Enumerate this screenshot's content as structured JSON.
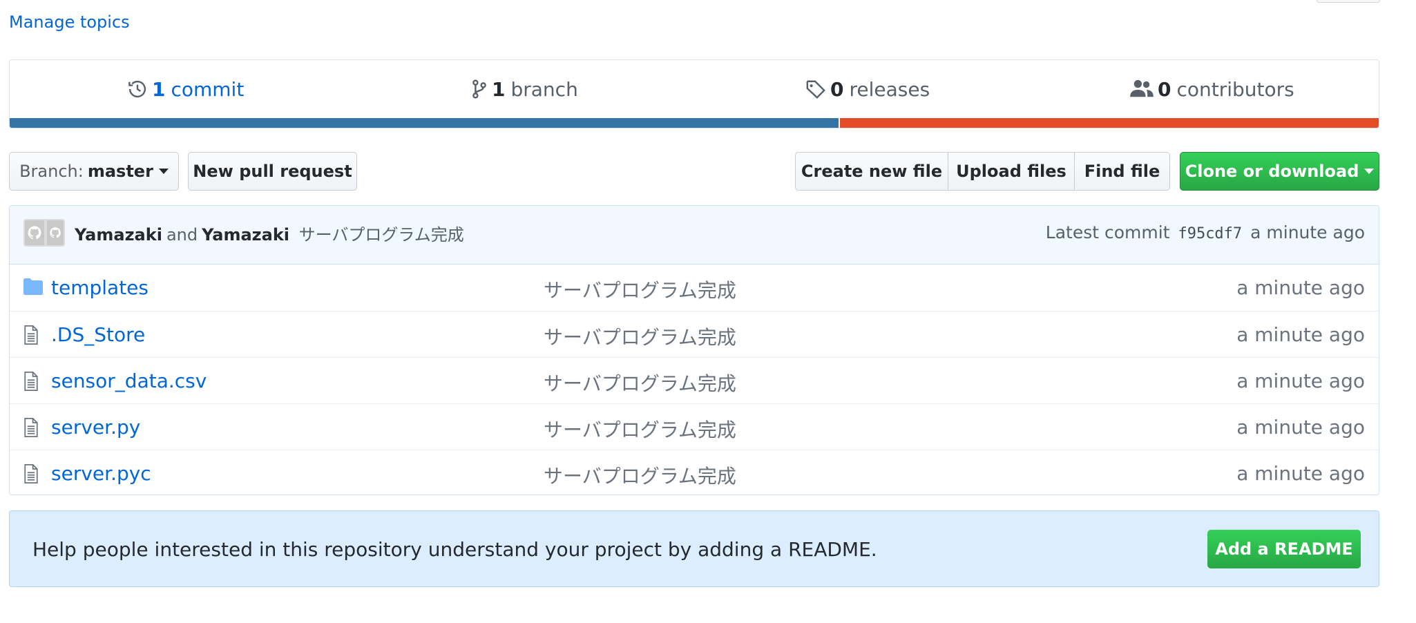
{
  "manage_topics": "Manage topics",
  "summary": {
    "commits": {
      "num": "1",
      "label": "commit"
    },
    "branches": {
      "num": "1",
      "label": "branch"
    },
    "releases": {
      "num": "0",
      "label": "releases"
    },
    "contributors": {
      "num": "0",
      "label": "contributors"
    },
    "languages": [
      {
        "color": "#3572A5",
        "percent": 60.6
      },
      {
        "color": "#e34c26",
        "percent": 39.4
      }
    ]
  },
  "toolbar": {
    "branch_prefix": "Branch:",
    "branch_name": "master",
    "new_pull_request": "New pull request",
    "create_new_file": "Create new file",
    "upload_files": "Upload files",
    "find_file": "Find file",
    "clone_or_download": "Clone or download"
  },
  "latest_commit": {
    "author1": "Yamazaki",
    "and": "and",
    "author2": "Yamazaki",
    "message": "サーバプログラム完成",
    "label": "Latest commit",
    "sha": "f95cdf7",
    "age": "a minute ago"
  },
  "files": [
    {
      "type": "folder-icon",
      "name": "templates",
      "message": "サーバプログラム完成",
      "age": "a minute ago"
    },
    {
      "type": "file-icon",
      "name": ".DS_Store",
      "message": "サーバプログラム完成",
      "age": "a minute ago"
    },
    {
      "type": "file-icon",
      "name": "sensor_data.csv",
      "message": "サーバプログラム完成",
      "age": "a minute ago"
    },
    {
      "type": "file-icon",
      "name": "server.py",
      "message": "サーバプログラム完成",
      "age": "a minute ago"
    },
    {
      "type": "file-icon",
      "name": "server.pyc",
      "message": "サーバプログラム完成",
      "age": "a minute ago"
    }
  ],
  "readme": {
    "text": "Help people interested in this repository understand your project by adding a README.",
    "button": "Add a README"
  }
}
